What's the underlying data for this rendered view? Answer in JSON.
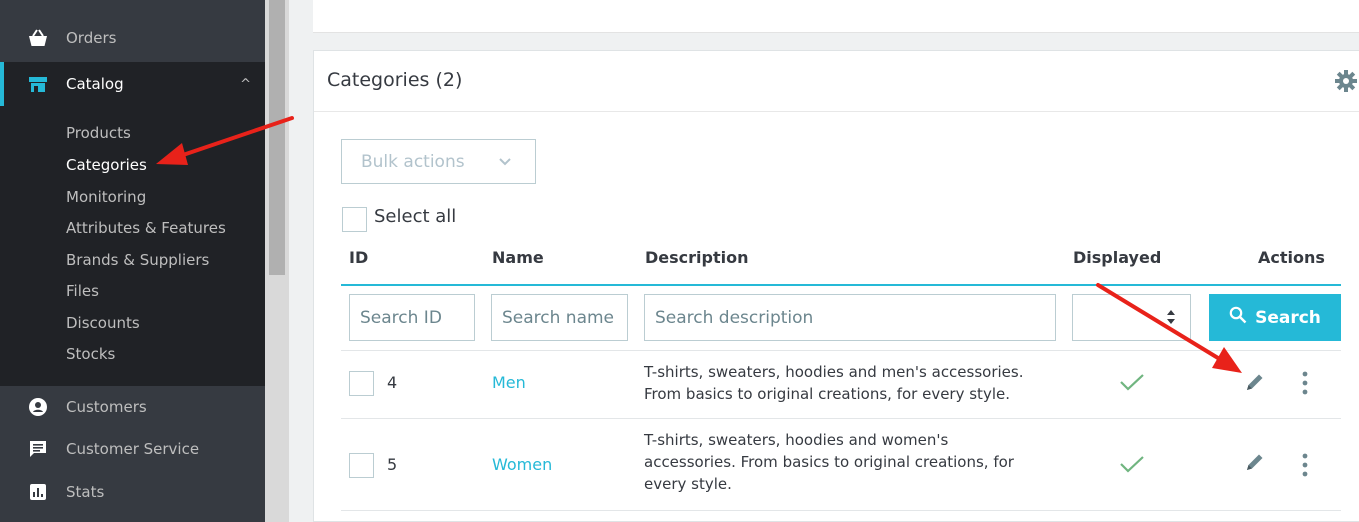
{
  "sidebar": {
    "orders": {
      "label": "Orders",
      "icon": "basket-icon"
    },
    "catalog": {
      "label": "Catalog",
      "icon": "store-icon",
      "chevron": "^"
    },
    "submenu": [
      "Products",
      "Categories",
      "Monitoring",
      "Attributes & Features",
      "Brands & Suppliers",
      "Files",
      "Discounts",
      "Stocks"
    ],
    "customers": {
      "label": "Customers",
      "icon": "account-icon"
    },
    "customer_service": {
      "label": "Customer Service",
      "icon": "chat-icon"
    },
    "stats": {
      "label": "Stats",
      "icon": "stats-icon"
    }
  },
  "card": {
    "title": "Categories (2)",
    "bulk_actions": "Bulk actions",
    "select_all": "Select all"
  },
  "table": {
    "headers": {
      "id": "ID",
      "name": "Name",
      "description": "Description",
      "displayed": "Displayed",
      "actions": "Actions"
    },
    "filters": {
      "id_placeholder": "Search ID",
      "name_placeholder": "Search name",
      "desc_placeholder": "Search description",
      "search_button": "Search"
    },
    "rows": [
      {
        "id": "4",
        "name": "Men",
        "description": "T-shirts, sweaters, hoodies and men's accessories. From basics to original creations, for every style.",
        "displayed": true
      },
      {
        "id": "5",
        "name": "Women",
        "description": "T-shirts, sweaters, hoodies and women's accessories. From basics to original creations, for every style.",
        "displayed": true
      }
    ]
  },
  "colors": {
    "accent": "#25b9d7",
    "sidebar": "#363a41",
    "check": "#70b580",
    "annotation": "#e8221a"
  }
}
